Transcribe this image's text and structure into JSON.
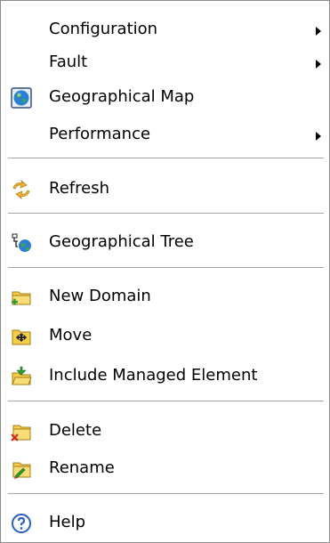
{
  "menu": {
    "items": [
      {
        "label": "Configuration",
        "icon": "",
        "submenu": true
      },
      {
        "label": "Fault",
        "icon": "",
        "submenu": true
      },
      {
        "label": "Geographical Map",
        "icon": "globe-icon",
        "submenu": false
      },
      {
        "label": "Performance",
        "icon": "",
        "submenu": true
      },
      {
        "label": "Refresh",
        "icon": "refresh-icon",
        "submenu": false
      },
      {
        "label": "Geographical Tree",
        "icon": "tree-globe-icon",
        "submenu": false
      },
      {
        "label": "New Domain",
        "icon": "new-folder-icon",
        "submenu": false
      },
      {
        "label": "Move",
        "icon": "move-folder-icon",
        "submenu": false
      },
      {
        "label": "Include Managed Element",
        "icon": "include-folder-icon",
        "submenu": false
      },
      {
        "label": "Delete",
        "icon": "delete-folder-icon",
        "submenu": false
      },
      {
        "label": "Rename",
        "icon": "rename-folder-icon",
        "submenu": false
      },
      {
        "label": "Help",
        "icon": "help-icon",
        "submenu": false
      }
    ]
  },
  "colors": {
    "background": "#ffffff",
    "separator": "#a6a6a6",
    "border": "#8c8c8c",
    "folder": "#f4cd4b",
    "globe": "#2a7fd4"
  }
}
